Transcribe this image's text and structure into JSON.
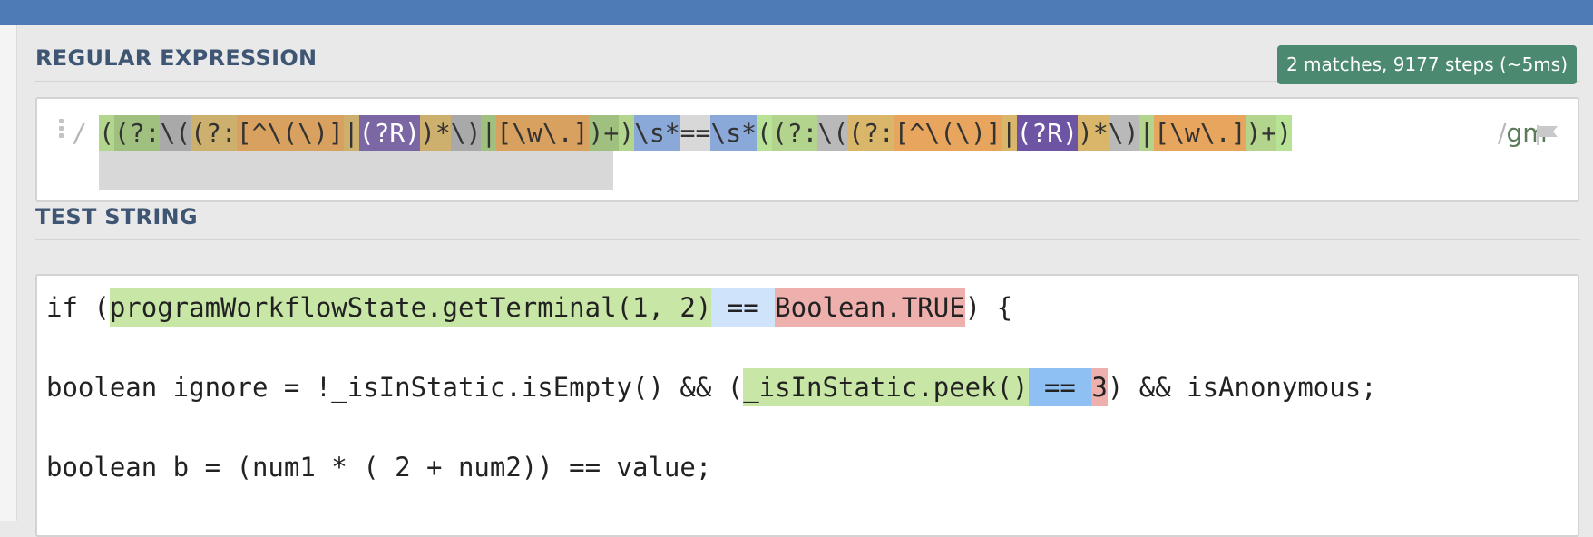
{
  "colors": {
    "topbar": "#4e7ab5",
    "badge": "#4b8a70",
    "label": "#3e5673",
    "match_group": "#c8e6a6",
    "match_space": "#cfe3fb",
    "match_space2": "#8fc0f4",
    "match_tail": "#eeb0ac"
  },
  "regex_section": {
    "title": "REGULAR EXPRESSION",
    "match_info": "2 matches, 9177 steps (~5ms)",
    "open_delimiter": "/",
    "close_delimiter": "/",
    "flags": "gm",
    "flag_icon": "flag-icon",
    "handle_icon": "drag-handle-icon",
    "tokens": [
      {
        "t": "(",
        "bg": "#b2d68e"
      },
      {
        "t": "(",
        "bg": "#a0c080"
      },
      {
        "t": "?:",
        "bg": "#a0c080"
      },
      {
        "t": "\\(",
        "bg": "#a9a9a9"
      },
      {
        "t": "(",
        "bg": "#cdb06d"
      },
      {
        "t": "?:",
        "bg": "#cdb06d"
      },
      {
        "t": "[^\\(\\)]",
        "bg": "#d9a15f"
      },
      {
        "t": "|",
        "bg": "#cdb06d"
      },
      {
        "t": "(?R)",
        "bg": "#7b67a3",
        "fg": "#ffffff"
      },
      {
        "t": ")*",
        "bg": "#cdb06d"
      },
      {
        "t": "\\)",
        "bg": "#a9a9a9"
      },
      {
        "t": "|",
        "bg": "#a0c080"
      },
      {
        "t": "[\\w\\.]",
        "bg": "#d9a15f"
      },
      {
        "t": ")+",
        "bg": "#a0c080"
      },
      {
        "t": ")",
        "bg": "#b2d68e"
      },
      {
        "t": "\\s*",
        "bg": "#8aa8d8"
      },
      {
        "t": "==",
        "bg": "#d8d8d8"
      },
      {
        "t": "\\s*",
        "bg": "#8aa8d8"
      },
      {
        "t": "(",
        "bg": "#b8e295"
      },
      {
        "t": "(",
        "bg": "#b3d48c"
      },
      {
        "t": "?:",
        "bg": "#b3d48c"
      },
      {
        "t": "\\(",
        "bg": "#b9b9b9"
      },
      {
        "t": "(?:",
        "bg": "#d9b66a"
      },
      {
        "t": "[^\\(\\)]",
        "bg": "#e7a55d"
      },
      {
        "t": "|",
        "bg": "#d9b66a"
      },
      {
        "t": "(?R)",
        "bg": "#6e55a3",
        "fg": "#ffffff"
      },
      {
        "t": ")*",
        "bg": "#d9b66a"
      },
      {
        "t": "\\)",
        "bg": "#b9b9b9"
      },
      {
        "t": "|",
        "bg": "#b3d48c"
      },
      {
        "t": "[\\w\\.]",
        "bg": "#e7a55d"
      },
      {
        "t": ")+",
        "bg": "#b3d48c"
      },
      {
        "t": ")",
        "bg": "#b8e295"
      }
    ]
  },
  "test_section": {
    "title": "TEST STRING",
    "lines": [
      [
        {
          "t": "if (",
          "bg": ""
        },
        {
          "t": "programWorkflowState.getTerminal(1, 2)",
          "bg": "#c8e6a6"
        },
        {
          "t": " == ",
          "bg": "#cfe3fb"
        },
        {
          "t": "Boolean.TRUE",
          "bg": "#eeb0ac"
        },
        {
          "t": ") {",
          "bg": ""
        }
      ],
      [
        {
          "t": "boolean ignore = !_isInStatic.isEmpty() && (",
          "bg": ""
        },
        {
          "t": "_isInStatic.peek()",
          "bg": "#c8e6a6"
        },
        {
          "t": " == ",
          "bg": "#8fc0f4"
        },
        {
          "t": "3",
          "bg": "#eeb0ac"
        },
        {
          "t": ") && isAnonymous;",
          "bg": ""
        }
      ],
      [
        {
          "t": "boolean b = (num1 * ( 2 + num2)) == value;",
          "bg": ""
        }
      ]
    ]
  }
}
